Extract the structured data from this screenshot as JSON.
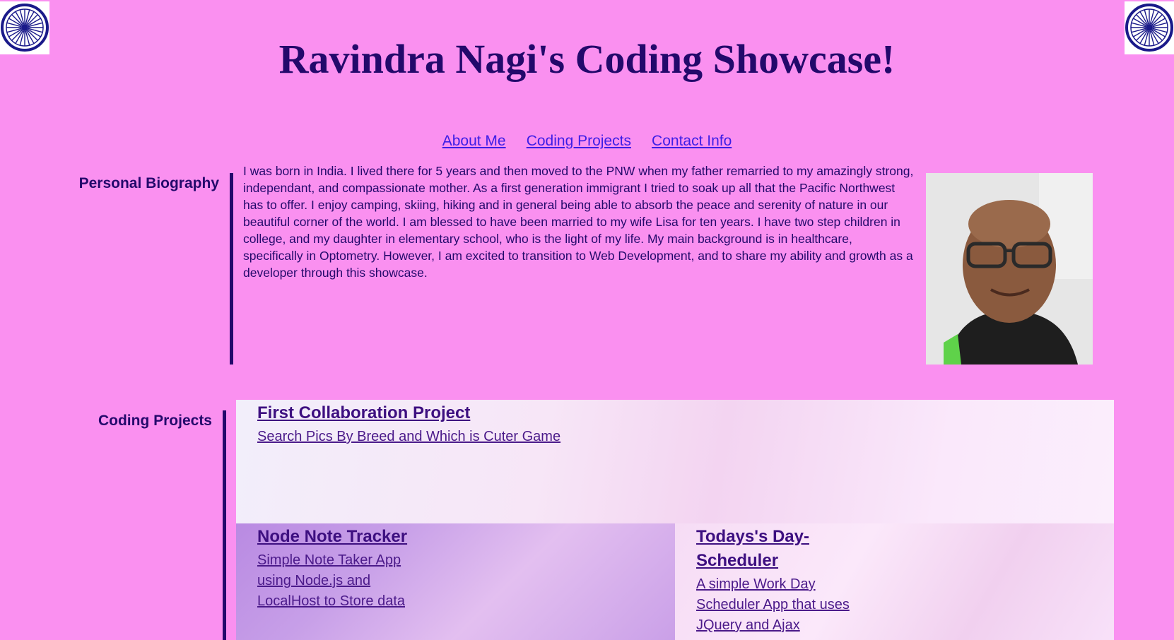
{
  "header": {
    "title": "Ravindra Nagi's Coding Showcase!"
  },
  "nav": {
    "items": [
      {
        "label": "About Me"
      },
      {
        "label": "Coding Projects"
      },
      {
        "label": "Contact Info"
      }
    ]
  },
  "biography": {
    "label": "Personal Biography",
    "text": "I was born in India. I lived there for 5 years and then moved to the PNW when my father remarried to my amazingly strong, independant, and compassionate mother. As a first generation immigrant I tried to soak up all that the Pacific Northwest has to offer. I enjoy camping, skiing, hiking and in general being able to absorb the peace and serenity of nature in our beautiful corner of the world. I am blessed to have been married to my wife Lisa for ten years. I have two step children in college, and my daughter in elementary school, who is the light of my life. My main background is in healthcare, specifically in Optometry. However, I am excited to transition to Web Development, and to share my ability and growth as a developer through this showcase."
  },
  "projects": {
    "label": "Coding Projects",
    "items": [
      {
        "title": "First Collaboration Project",
        "description": "Search Pics By Breed and Which is Cuter Game"
      },
      {
        "title": "Node Note Tracker",
        "description": "Simple Note Taker App using Node.js and LocalHost to Store data"
      },
      {
        "title": "Todays's Day-Scheduler",
        "description": "A simple Work Day Scheduler App that uses JQuery and Ajax"
      }
    ]
  },
  "colors": {
    "background": "#fa90f0",
    "accent": "#23096b",
    "link": "#3d1ee6"
  },
  "icons": {
    "emblem": "ashoka-chakra-icon",
    "photo": "profile-photo"
  }
}
